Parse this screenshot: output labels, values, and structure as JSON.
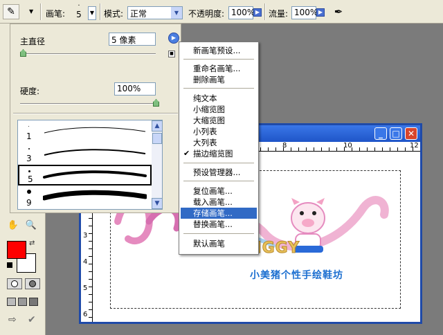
{
  "options_bar": {
    "brush_label": "画笔:",
    "brush_size": "5",
    "mode_label": "模式:",
    "mode_value": "正常",
    "opacity_label": "不透明度:",
    "opacity_value": "100%",
    "flow_label": "流量:",
    "flow_value": "100%"
  },
  "brush_panel": {
    "diameter_label": "主直径",
    "diameter_value": "5 像素",
    "hardness_label": "硬度:",
    "hardness_value": "100%",
    "brushes": [
      {
        "size": "1",
        "selected": false
      },
      {
        "size": "3",
        "selected": false
      },
      {
        "size": "5",
        "selected": true
      },
      {
        "size": "9",
        "selected": false
      }
    ]
  },
  "menu": {
    "items": [
      {
        "label": "新画笔预设...",
        "checked": false,
        "highlighted": false
      },
      {
        "label": "重命名画笔...",
        "checked": false,
        "highlighted": false
      },
      {
        "label": "删除画笔",
        "checked": false,
        "highlighted": false
      },
      {
        "label": "纯文本",
        "checked": false,
        "highlighted": false
      },
      {
        "label": "小缩览图",
        "checked": false,
        "highlighted": false
      },
      {
        "label": "大缩览图",
        "checked": false,
        "highlighted": false
      },
      {
        "label": "小列表",
        "checked": false,
        "highlighted": false
      },
      {
        "label": "大列表",
        "checked": false,
        "highlighted": false
      },
      {
        "label": "描边缩览图",
        "checked": true,
        "highlighted": false
      },
      {
        "label": "预设管理器...",
        "checked": false,
        "highlighted": false
      },
      {
        "label": "复位画笔...",
        "checked": false,
        "highlighted": false
      },
      {
        "label": "载入画笔...",
        "checked": false,
        "highlighted": false
      },
      {
        "label": "存储画笔...",
        "checked": false,
        "highlighted": true
      },
      {
        "label": "替换画笔...",
        "checked": false,
        "highlighted": false
      },
      {
        "label": "默认画笔",
        "checked": false,
        "highlighted": false
      }
    ]
  },
  "document": {
    "ruler_h": [
      "8",
      "10",
      "12"
    ],
    "ruler_v": [
      "2",
      "3",
      "4",
      "5",
      "6"
    ],
    "art_brand": "FAIR PIGGY",
    "art_tagline": "小美猪个性手绘鞋坊"
  },
  "colors": {
    "foreground": "#ff0000",
    "background": "#ffffff",
    "menu_highlight": "#316ac5",
    "title_bar": "#1f55c8"
  }
}
